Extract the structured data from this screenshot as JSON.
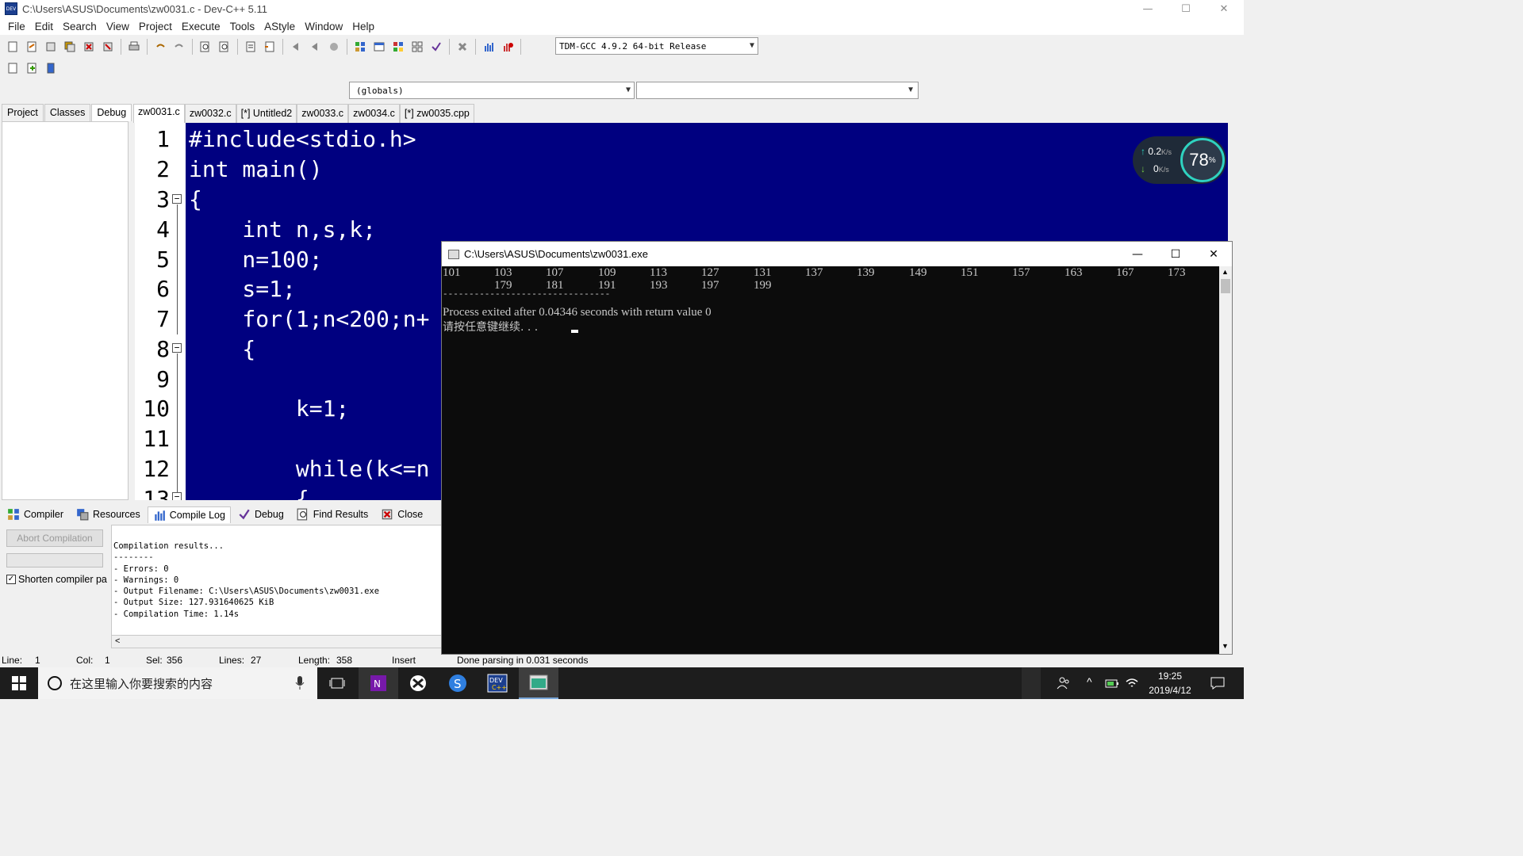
{
  "window": {
    "title": "C:\\Users\\ASUS\\Documents\\zw0031.c - Dev-C++ 5.11",
    "icon_text": "DEV"
  },
  "menu": [
    "File",
    "Edit",
    "Search",
    "View",
    "Project",
    "Execute",
    "Tools",
    "AStyle",
    "Window",
    "Help"
  ],
  "toolbar": {
    "compiler": "TDM-GCC 4.9.2 64-bit Release",
    "globals": "(globals)"
  },
  "left_tabs": [
    "Project",
    "Classes",
    "Debug"
  ],
  "editor_tabs": [
    "zw0031.c",
    "zw0032.c",
    "[*] Untitled2",
    "zw0033.c",
    "zw0034.c",
    "[*] zw0035.cpp"
  ],
  "code": {
    "line_numbers": [
      "1",
      "2",
      "3",
      "4",
      "5",
      "6",
      "7",
      "8",
      "9",
      "10",
      "11",
      "12",
      "13"
    ],
    "lines": [
      "#include<stdio.h>",
      "int main()",
      "{",
      "    int n,s,k;",
      "    n=100;",
      "    s=1;",
      "    for(1;n<200;n+",
      "    {",
      "",
      "        k=1;",
      "",
      "        while(k<=n",
      "        {"
    ]
  },
  "net_widget": {
    "up": "0.2",
    "down": "0",
    "unit": "K/s",
    "percent": "78",
    "percent_sign": "%"
  },
  "bottom_tabs": [
    "Compiler",
    "Resources",
    "Compile Log",
    "Debug",
    "Find Results",
    "Close"
  ],
  "compile_panel": {
    "abort_label": "Abort Compilation",
    "shorten_label": "Shorten compiler pa",
    "shorten_checked": "✓",
    "log": [
      "Compilation results...",
      "--------",
      "- Errors: 0",
      "- Warnings: 0",
      "- Output Filename: C:\\Users\\ASUS\\Documents\\zw0031.exe",
      "- Output Size: 127.931640625 KiB",
      "- Compilation Time: 1.14s"
    ],
    "scroll_left": "<"
  },
  "statusbar": {
    "line_label": "Line:",
    "line": "1",
    "col_label": "Col:",
    "col": "1",
    "sel_label": "Sel:",
    "sel": "356",
    "lines_label": "Lines:",
    "lines": "27",
    "length_label": "Length:",
    "length": "358",
    "mode": "Insert",
    "message": "Done parsing in 0.031 seconds"
  },
  "console": {
    "title": "C:\\Users\\ASUS\\Documents\\zw0031.exe",
    "row1": [
      "101",
      "103",
      "107",
      "109",
      "113",
      "127",
      "131",
      "137",
      "139",
      "149",
      "151",
      "157",
      "163",
      "167",
      "173"
    ],
    "row2": [
      "179",
      "181",
      "191",
      "193",
      "197",
      "199"
    ],
    "separator": "--------------------------------",
    "exit_line": "Process exited after 0.04346 seconds with return value 0",
    "prompt": "请按任意键继续. . ."
  },
  "taskbar": {
    "search_placeholder": "在这里输入你要搜索的内容",
    "time": "19:25",
    "date": "2019/4/12"
  }
}
